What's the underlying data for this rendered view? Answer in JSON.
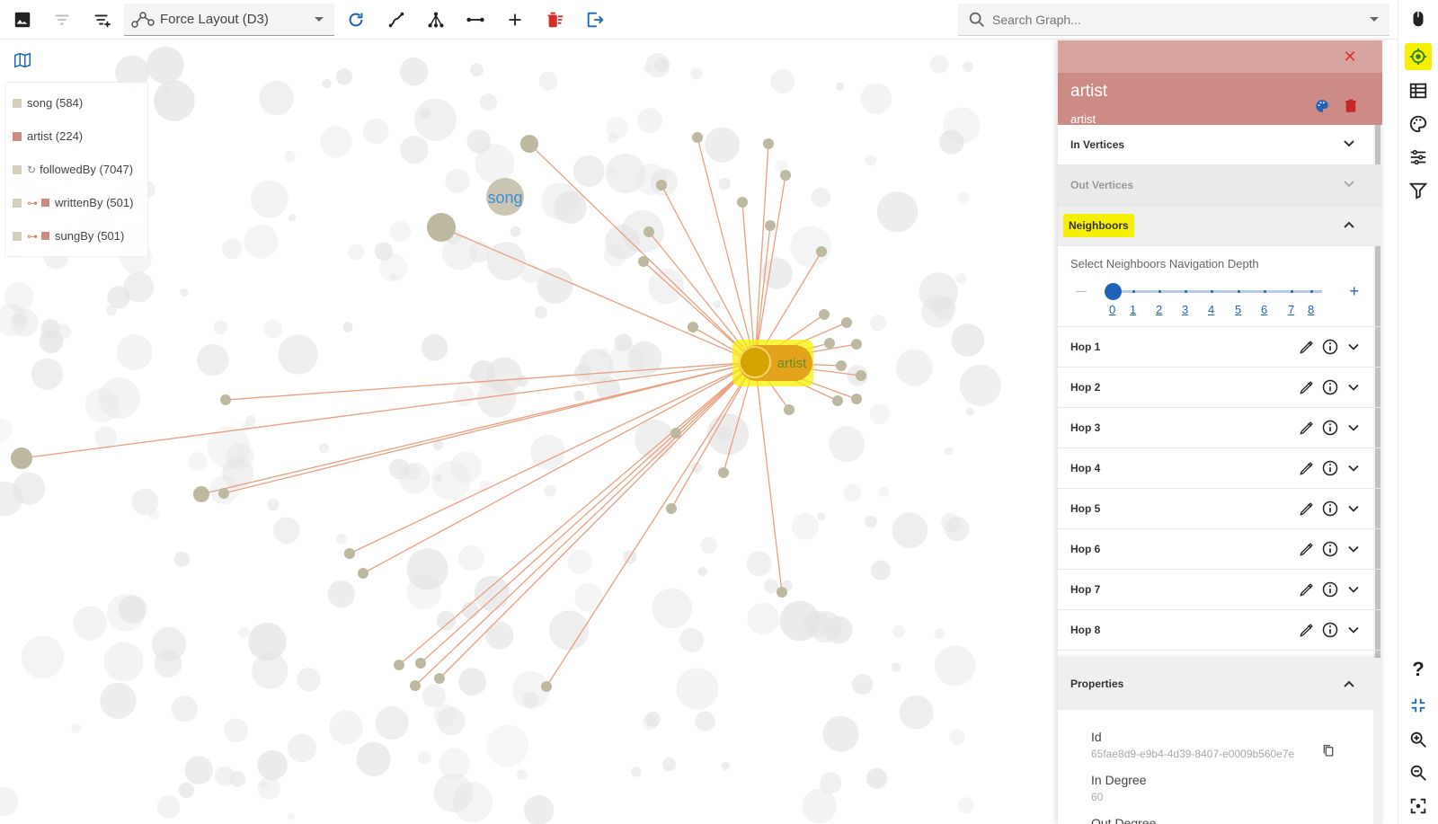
{
  "toolbar": {
    "layout_label": "Force Layout (D3)",
    "search_placeholder": "Search Graph..."
  },
  "legend": {
    "items": [
      {
        "label": "song (584)",
        "color": "#d4d0bd"
      },
      {
        "label": "artist (224)",
        "color": "#cd8b85"
      },
      {
        "label": "followedBy (7047)",
        "color": "#e07a5a"
      },
      {
        "label": "writtenBy (501)",
        "color": "#e07a5a"
      },
      {
        "label": "sungBy (501)",
        "color": "#e07a5a"
      }
    ]
  },
  "graph": {
    "selected_label": "artist",
    "hover_label": "song",
    "node_color": "#bdb8a0",
    "edge_color": "#e8a080",
    "selected_color": "#d4a300",
    "highlight_color": "#f5f000"
  },
  "panel": {
    "title": "artist",
    "subtitle": "artist",
    "header_color": "#cd8b85",
    "sections": {
      "in_vertices": "In Vertices",
      "out_vertices": "Out Vertices",
      "neighbors": "Neighboors"
    },
    "depth_label": "Select Neighboors Navigation Depth",
    "depth_value": 0,
    "depth_ticks": [
      "0",
      "1",
      "2",
      "3",
      "4",
      "5",
      "6",
      "7",
      "8"
    ],
    "hops": [
      "Hop 1",
      "Hop 2",
      "Hop 3",
      "Hop 4",
      "Hop 5",
      "Hop 6",
      "Hop 7",
      "Hop 8"
    ],
    "properties_label": "Properties",
    "properties": [
      {
        "key": "Id",
        "value": "65fae8d9-e9b4-4d39-8407-e0009b560e7e"
      },
      {
        "key": "In Degree",
        "value": "60"
      },
      {
        "key": "Out Degree",
        "value": ""
      }
    ]
  },
  "rail": {
    "help": "?"
  }
}
